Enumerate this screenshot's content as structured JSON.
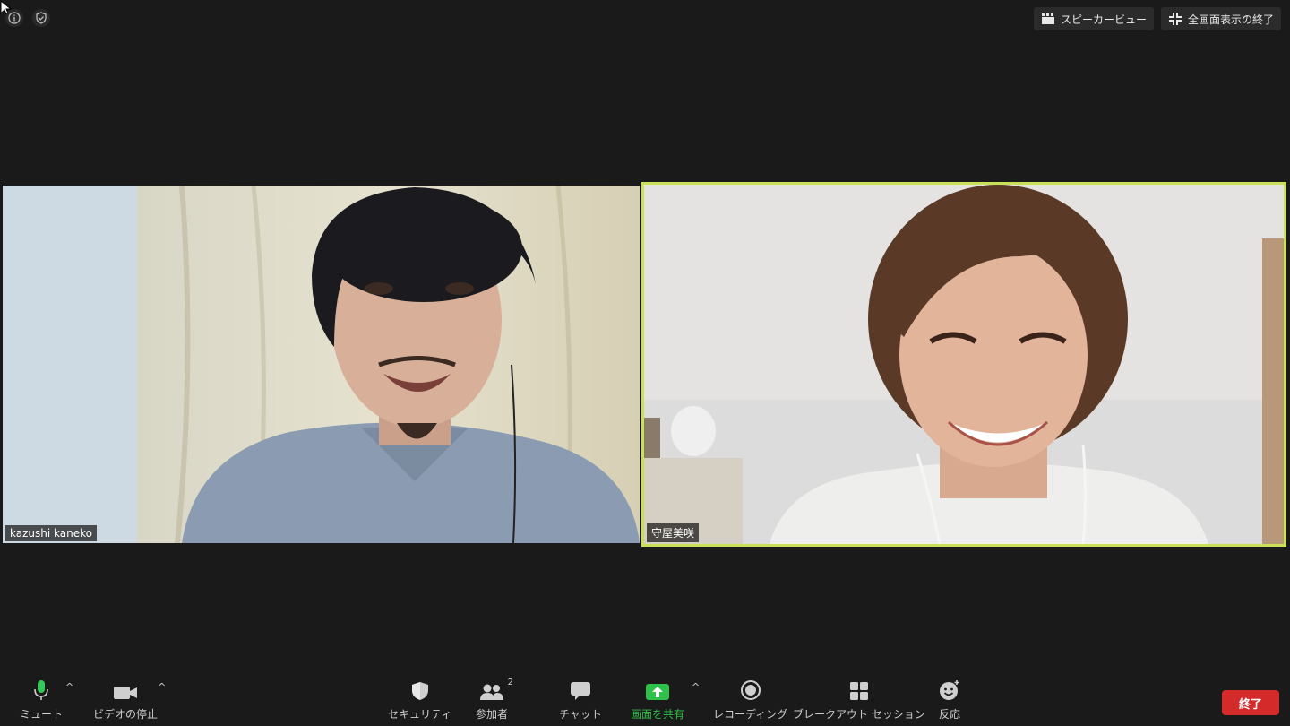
{
  "top_right": {
    "speaker_view": "スピーカービュー",
    "exit_fullscreen": "全画面表示の終了"
  },
  "participants": [
    {
      "name": "kazushi kaneko",
      "active": false
    },
    {
      "name": "守屋美咲",
      "active": true
    }
  ],
  "toolbar": {
    "mute": "ミュート",
    "stop_video": "ビデオの停止",
    "security": "セキュリティ",
    "participants": "参加者",
    "participants_count": "2",
    "chat": "チャット",
    "share_screen": "画面を共有",
    "recording": "レコーディング",
    "breakout": "ブレークアウト セッション",
    "reactions": "反応",
    "end": "終了"
  },
  "colors": {
    "active_speaker_border": "#c8e05a",
    "share_green": "#2fc24a",
    "end_red": "#d42a2a",
    "mic_green": "#34c759"
  }
}
